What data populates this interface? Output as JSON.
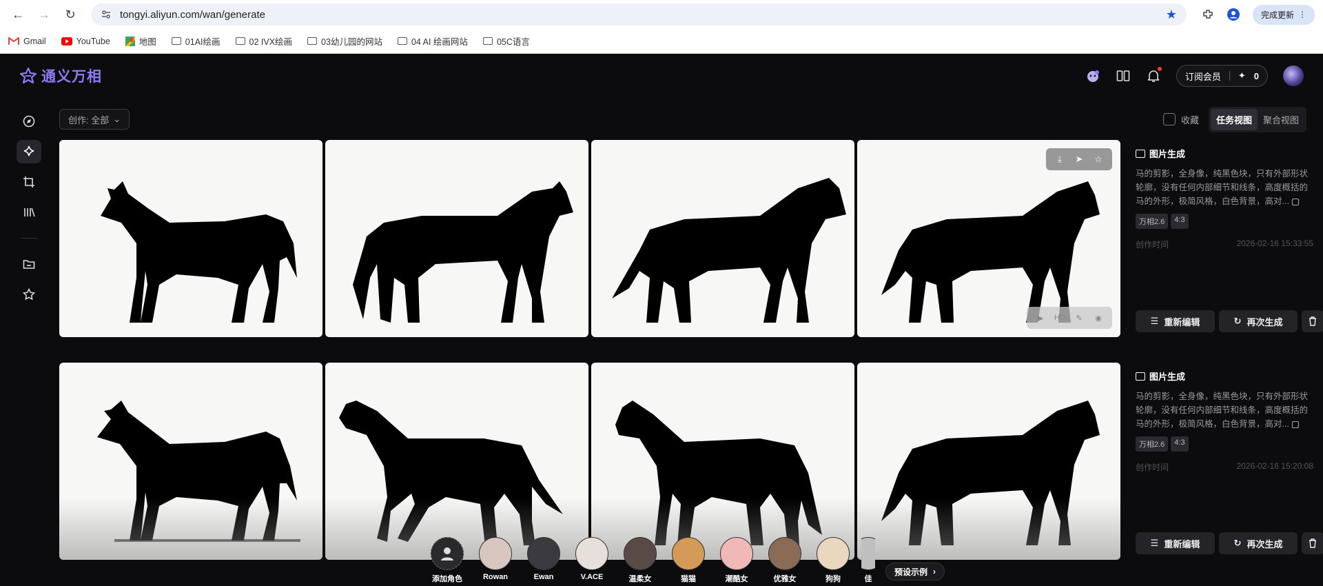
{
  "browser": {
    "url": "tongyi.aliyun.com/wan/generate",
    "update_label": "完成更新",
    "bookmarks": [
      {
        "label": "Gmail"
      },
      {
        "label": "YouTube"
      },
      {
        "label": "地图"
      },
      {
        "label": "01AI绘画"
      },
      {
        "label": "02 IVX绘画"
      },
      {
        "label": "03幼儿园的网站"
      },
      {
        "label": "04 AI 绘画网站"
      },
      {
        "label": "05C语言"
      }
    ]
  },
  "app": {
    "logo_text": "通义万相",
    "subscribe_label": "订阅会员",
    "credits": "0"
  },
  "toolbar": {
    "filter_label": "创作: 全部",
    "favorites_label": "收藏",
    "view_task": "任务视图",
    "view_aggregate": "聚合视图"
  },
  "tasks": [
    {
      "title": "图片生成",
      "prompt": "马的剪影，全身像，纯黑色块，只有外部形状轮廓，没有任何内部细节和线条，高度概括的马的外形，极简风格，白色背景，高对...",
      "tags": [
        "万相2.6",
        "4:3"
      ],
      "time_label": "创作时间",
      "time_value": "2026-02-16 15:33:55",
      "edit_label": "重新编辑",
      "regen_label": "再次生成"
    },
    {
      "title": "图片生成",
      "prompt": "马的剪影，全身像，纯黑色块，只有外部形状轮廓，没有任何内部细节和线条，高度概括的马的外形，极简风格，白色背景，高对...",
      "tags": [
        "万相2.6",
        "4:3"
      ],
      "time_label": "创作时间",
      "time_value": "2026-02-16 15:20:08",
      "edit_label": "重新编辑",
      "regen_label": "再次生成"
    }
  ],
  "characters": {
    "add_label": "添加角色",
    "items": [
      {
        "name": "Rowan",
        "color": "#d8c6c0"
      },
      {
        "name": "Ewan",
        "color": "#3b3a40"
      },
      {
        "name": "V.ACE",
        "color": "#e7e0da"
      },
      {
        "name": "温柔女",
        "color": "#5a4a46"
      },
      {
        "name": "猫猫",
        "color": "#d49a58"
      },
      {
        "name": "潮酷女",
        "color": "#f0b9b8"
      },
      {
        "name": "优雅女",
        "color": "#8a6b55"
      },
      {
        "name": "狗狗",
        "color": "#e9d7c0"
      },
      {
        "name": "佳",
        "color": "#bfbfbf"
      }
    ],
    "preset_label": "预设示例"
  }
}
